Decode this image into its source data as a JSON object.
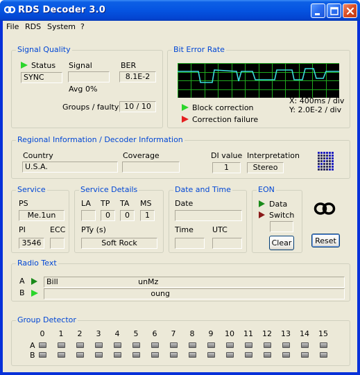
{
  "window": {
    "title": "RDS Decoder 3.0"
  },
  "menu": [
    "File",
    "RDS",
    "System",
    "?"
  ],
  "signal_quality": {
    "title": "Signal Quality",
    "status_label": "Status",
    "status_value": "SYNC",
    "signal_label": "Signal",
    "signal_value": "",
    "avg_label": "Avg",
    "avg_value": "0%",
    "ber_label": "BER",
    "ber_value": "8.1E-2",
    "groups_label": "Groups / faulty",
    "groups_value": "10 / 10"
  },
  "ber_panel": {
    "title": "Bit Error Rate",
    "x_scale": "X: 400ms / div",
    "y_scale": "Y: 2.0E-2 / div",
    "block_correction": "Block correction",
    "correction_failure": "Correction failure",
    "trace_color": "#3bdcdc",
    "grid_color": "#1faa1f"
  },
  "regional": {
    "title": "Regional Information / Decoder Information",
    "country_label": "Country",
    "country_value": "U.S.A.",
    "coverage_label": "Coverage",
    "coverage_value": "",
    "di_label": "DI value",
    "di_value": "1",
    "interp_label": "Interpretation",
    "interp_value": "Stereo"
  },
  "service": {
    "title": "Service",
    "ps_label": "PS",
    "ps_value": "Me.1un",
    "pi_label": "PI",
    "pi_value": "3546",
    "ecc_label": "ECC",
    "ecc_value": ""
  },
  "service_details": {
    "title": "Service Details",
    "la_label": "LA",
    "la_value": "",
    "tp_label": "TP",
    "tp_value": "0",
    "ta_label": "TA",
    "ta_value": "0",
    "ms_label": "MS",
    "ms_value": "1",
    "pty_label": "PTy (s)",
    "pty_value": "Soft Rock"
  },
  "date_time": {
    "title": "Date and Time",
    "date_label": "Date",
    "date_value": "",
    "time_label": "Time",
    "time_value": "",
    "utc_label": "UTC",
    "utc_value": ""
  },
  "eon": {
    "title": "EON",
    "data_label": "Data",
    "switch_label": "Switch",
    "clear_button": "Clear"
  },
  "reset_button": "Reset",
  "radio_text": {
    "title": "Radio Text",
    "a_label": "A",
    "a_value": "Bill                                 unMz",
    "b_label": "B",
    "b_value": "                                           oung"
  },
  "group_detector": {
    "title": "Group Detector",
    "numbers": [
      "0",
      "1",
      "2",
      "3",
      "4",
      "5",
      "6",
      "7",
      "8",
      "9",
      "10",
      "11",
      "12",
      "13",
      "14",
      "15"
    ],
    "row_a": "A",
    "row_b": "B"
  }
}
